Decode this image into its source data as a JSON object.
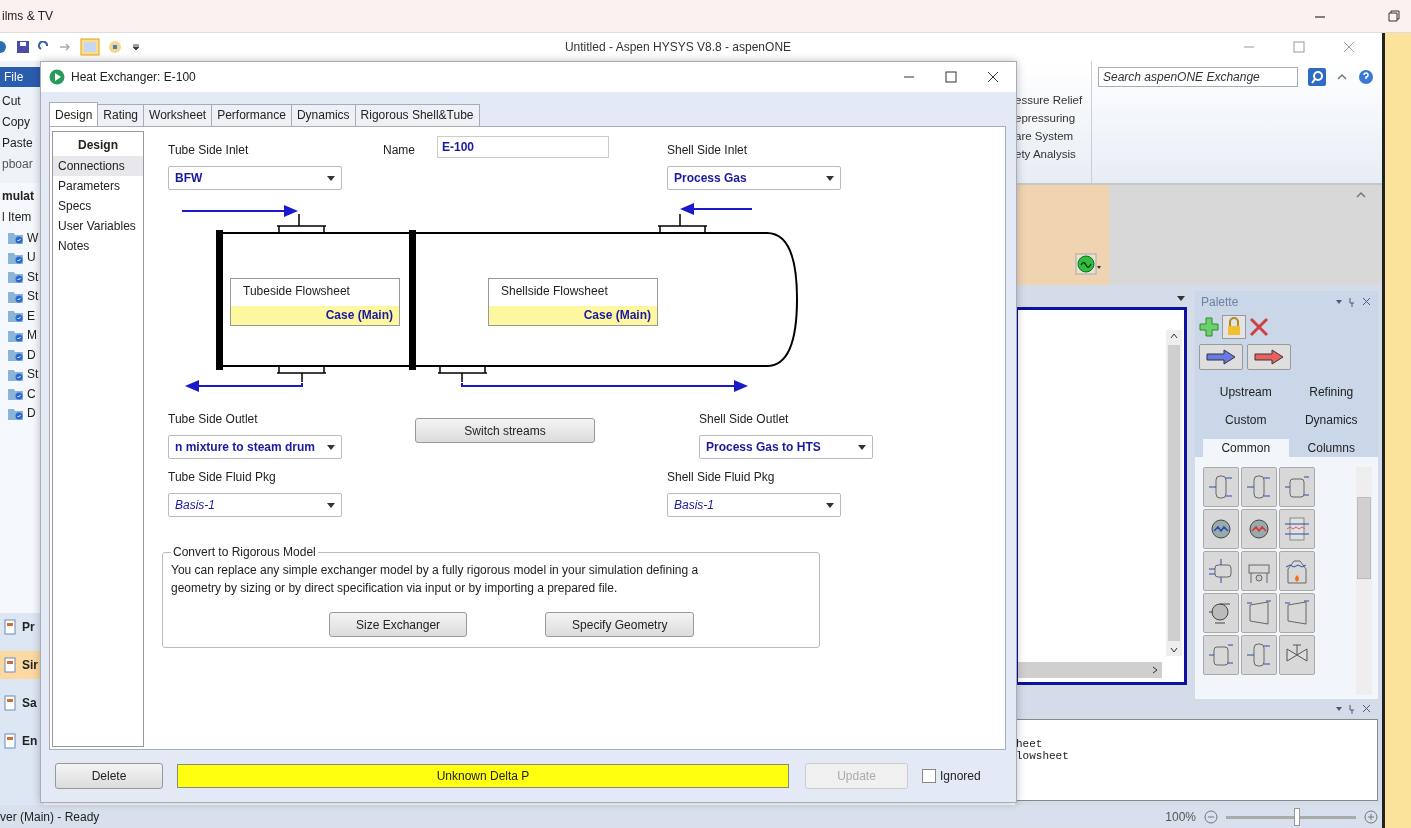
{
  "top_bar": {
    "title": "ilms & TV"
  },
  "app": {
    "title": "Untitled - Aspen HYSYS V8.8 - aspenONE",
    "file_tab": "File",
    "clipboard": [
      "Cut",
      "Copy",
      "Paste"
    ],
    "clipboard_group": "pboar",
    "nav_header": "mulat",
    "nav_subheader": "l Item",
    "tree_items": [
      "W",
      "U",
      "St",
      "St",
      "E",
      "M",
      "D",
      "St",
      "C",
      "D"
    ],
    "nav_buttons": [
      {
        "label": "Pr",
        "selected": false
      },
      {
        "label": "Sir",
        "selected": true
      },
      {
        "label": "Sa",
        "selected": false
      },
      {
        "label": "En",
        "selected": false
      }
    ],
    "safety_items": [
      "essure Relief",
      "epressuring",
      "are System",
      "ety Analysis"
    ],
    "search": {
      "placeholder": "Search aspenONE Exchange"
    },
    "palette": {
      "title": "Palette",
      "tabs": [
        {
          "label": "Upstream",
          "selected": false
        },
        {
          "label": "Refining",
          "selected": false
        },
        {
          "label": "Custom",
          "selected": false
        },
        {
          "label": "Dynamics",
          "selected": false
        },
        {
          "label": "Common",
          "selected": true
        },
        {
          "label": "Columns",
          "selected": false
        }
      ]
    },
    "messages": [
      "heet",
      "lowsheet"
    ],
    "status": "ver (Main) - Ready",
    "zoom": "100%",
    "zoom_slider": {
      "level": 0.55
    }
  },
  "dialog": {
    "title": "Heat Exchanger: E-100",
    "tabs": [
      {
        "label": "Design",
        "selected": true
      },
      {
        "label": "Rating",
        "selected": false
      },
      {
        "label": "Worksheet",
        "selected": false
      },
      {
        "label": "Performance",
        "selected": false
      },
      {
        "label": "Dynamics",
        "selected": false
      },
      {
        "label": "Rigorous Shell&Tube",
        "selected": false
      }
    ],
    "nav_title": "Design",
    "nav_items": [
      {
        "label": "Connections",
        "selected": true
      },
      {
        "label": "Parameters",
        "selected": false
      },
      {
        "label": "Specs",
        "selected": false
      },
      {
        "label": "User Variables",
        "selected": false
      },
      {
        "label": "Notes",
        "selected": false
      }
    ],
    "tube_inlet": {
      "label": "Tube Side Inlet",
      "value": "BFW"
    },
    "name": {
      "label": "Name",
      "value": "E-100"
    },
    "shell_inlet": {
      "label": "Shell Side Inlet",
      "value": "Process Gas"
    },
    "tubeside_box": {
      "title": "Tubeside Flowsheet",
      "case": "Case (Main)"
    },
    "shellside_box": {
      "title": "Shellside Flowsheet",
      "case": "Case (Main)"
    },
    "tube_outlet": {
      "label": "Tube Side Outlet",
      "value": "n mixture to steam drum"
    },
    "switch_button": "Switch streams",
    "shell_outlet": {
      "label": "Shell Side Outlet",
      "value": "Process Gas to HTS"
    },
    "tube_pkg": {
      "label": "Tube Side Fluid Pkg",
      "value": "Basis-1"
    },
    "shell_pkg": {
      "label": "Shell Side Fluid Pkg",
      "value": "Basis-1"
    },
    "rigorous": {
      "title": "Convert to Rigorous Model",
      "text": "You can replace any simple exchanger model by a fully rigorous model in your simulation defining a geometry by sizing or by direct specification via input or by importing a prepared file.",
      "buttons": [
        "Size Exchanger",
        "Specify Geometry"
      ]
    },
    "delete_button": "Delete",
    "status": "Unknown Delta P",
    "update_button": {
      "label": "Update",
      "disabled": true
    },
    "ignored": {
      "label": "Ignored",
      "checked": false
    }
  }
}
